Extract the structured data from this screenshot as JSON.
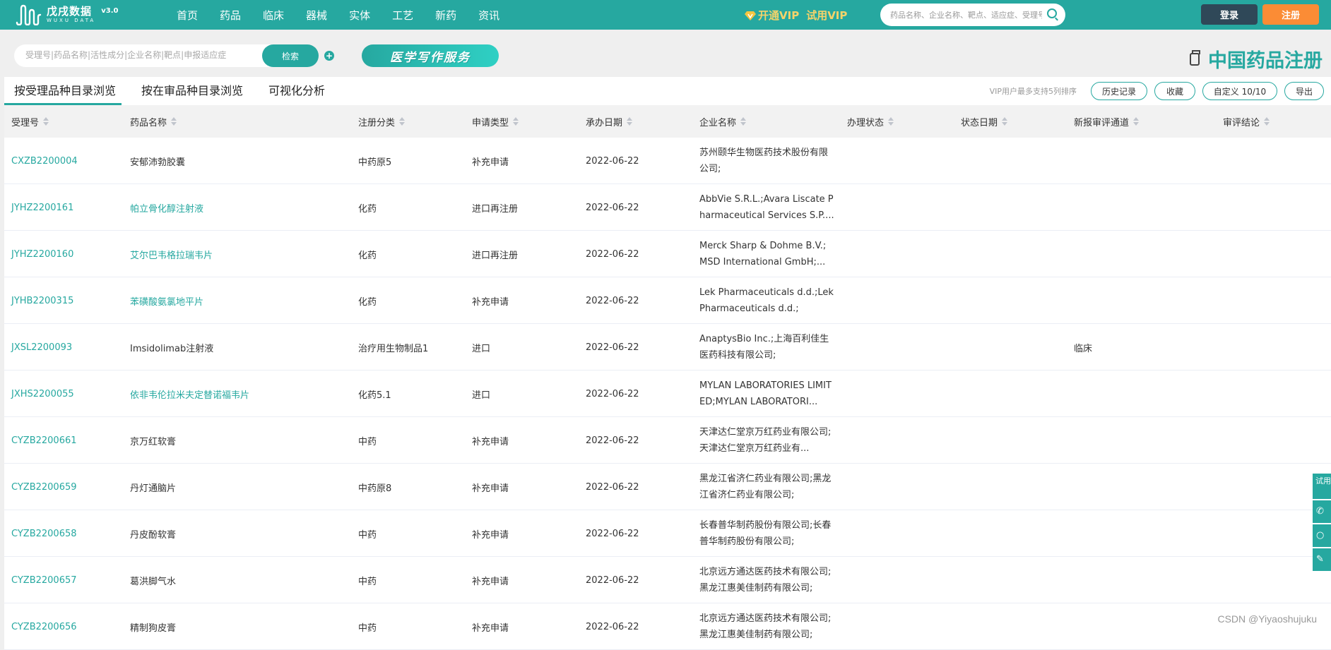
{
  "header": {
    "logo_cn": "戊戌数据",
    "logo_en": "WUXU DATA",
    "version": "v3.0",
    "nav": [
      "首页",
      "药品",
      "临床",
      "器械",
      "实体",
      "工艺",
      "新药",
      "资讯"
    ],
    "vip_open": "开通VIP",
    "vip_trial": "试用VIP",
    "search_placeholder": "药品名称、企业名称、靶点、适应症、受理号、批准文号、CTR号、NCT号",
    "login": "登录",
    "register": "注册",
    "brand_color": "#26a8a0",
    "login_color": "#2f4858",
    "register_color": "#fb8c35"
  },
  "subbar": {
    "search_placeholder": "受理号|药品名称|活性成分|企业名称|靶点|申报适应症",
    "search_button": "检索",
    "plus": "+",
    "banner": "医学写作服务",
    "page_title": "中国药品注册"
  },
  "tabs": [
    {
      "label": "按受理品种目录浏览",
      "active": true
    },
    {
      "label": "按在审品种目录浏览",
      "active": false
    },
    {
      "label": "可视化分析",
      "active": false
    }
  ],
  "tools": {
    "hint": "VIP用户最多支持5列排序",
    "history": "历史记录",
    "favorite": "收藏",
    "customize": "自定义 10/10",
    "export": "导出"
  },
  "table": {
    "columns": [
      "受理号",
      "药品名称",
      "注册分类",
      "申请类型",
      "承办日期",
      "企业名称",
      "办理状态",
      "状态日期",
      "新报审评通道",
      "审评结论"
    ],
    "rows": [
      {
        "id": "CXZB2200004",
        "name": "安郁沛勃胶囊",
        "name_link": false,
        "category": "中药原5",
        "type": "补充申请",
        "date": "2022-06-22",
        "company": "苏州颐华生物医药技术股份有限公司;",
        "status": "",
        "status_date": "",
        "channel": "",
        "conclusion": ""
      },
      {
        "id": "JYHZ2200161",
        "name": "帕立骨化醇注射液",
        "name_link": true,
        "category": "化药",
        "type": "进口再注册",
        "date": "2022-06-22",
        "company": "AbbVie S.R.L.;Avara Liscate Pharmaceutical Services S.P....",
        "status": "",
        "status_date": "",
        "channel": "",
        "conclusion": ""
      },
      {
        "id": "JYHZ2200160",
        "name": "艾尔巴韦格拉瑞韦片",
        "name_link": true,
        "category": "化药",
        "type": "进口再注册",
        "date": "2022-06-22",
        "company": "Merck Sharp & Dohme B.V.; MSD International GmbH;...",
        "status": "",
        "status_date": "",
        "channel": "",
        "conclusion": ""
      },
      {
        "id": "JYHB2200315",
        "name": "苯磺酸氨氯地平片",
        "name_link": true,
        "category": "化药",
        "type": "补充申请",
        "date": "2022-06-22",
        "company": "Lek Pharmaceuticals d.d.;Lek Pharmaceuticals d.d.;",
        "status": "",
        "status_date": "",
        "channel": "",
        "conclusion": ""
      },
      {
        "id": "JXSL2200093",
        "name": "Imsidolimab注射液",
        "name_link": false,
        "category": "治疗用生物制品1",
        "type": "进口",
        "date": "2022-06-22",
        "company": "AnaptysBio Inc.;上海百利佳生医药科技有限公司;",
        "status": "",
        "status_date": "",
        "channel": "临床",
        "conclusion": ""
      },
      {
        "id": "JXHS2200055",
        "name": "依非韦伦拉米夫定替诺福韦片",
        "name_link": true,
        "category": "化药5.1",
        "type": "进口",
        "date": "2022-06-22",
        "company": "MYLAN LABORATORIES LIMITED;MYLAN LABORATORI...",
        "status": "",
        "status_date": "",
        "channel": "",
        "conclusion": ""
      },
      {
        "id": "CYZB2200661",
        "name": "京万红软膏",
        "name_link": false,
        "category": "中药",
        "type": "补充申请",
        "date": "2022-06-22",
        "company": "天津达仁堂京万红药业有限公司;天津达仁堂京万红药业有...",
        "status": "",
        "status_date": "",
        "channel": "",
        "conclusion": ""
      },
      {
        "id": "CYZB2200659",
        "name": "丹灯通脑片",
        "name_link": false,
        "category": "中药原8",
        "type": "补充申请",
        "date": "2022-06-22",
        "company": "黑龙江省济仁药业有限公司;黑龙江省济仁药业有限公司;",
        "status": "",
        "status_date": "",
        "channel": "",
        "conclusion": ""
      },
      {
        "id": "CYZB2200658",
        "name": "丹皮酚软膏",
        "name_link": false,
        "category": "中药",
        "type": "补充申请",
        "date": "2022-06-22",
        "company": "长春普华制药股份有限公司;长春普华制药股份有限公司;",
        "status": "",
        "status_date": "",
        "channel": "",
        "conclusion": ""
      },
      {
        "id": "CYZB2200657",
        "name": "葛洪脚气水",
        "name_link": false,
        "category": "中药",
        "type": "补充申请",
        "date": "2022-06-22",
        "company": "北京远方通达医药技术有限公司;黑龙江惠美佳制药有限公司;",
        "status": "",
        "status_date": "",
        "channel": "",
        "conclusion": ""
      },
      {
        "id": "CYZB2200656",
        "name": "精制狗皮膏",
        "name_link": false,
        "category": "中药",
        "type": "补充申请",
        "date": "2022-06-22",
        "company": "北京远方通达医药技术有限公司;黑龙江惠美佳制药有限公司;",
        "status": "",
        "status_date": "",
        "channel": "",
        "conclusion": ""
      }
    ]
  },
  "float": {
    "trial": "试用申请",
    "icons": [
      "phone-icon",
      "wechat-icon",
      "feedback-icon"
    ]
  },
  "watermark": "CSDN @Yiyaoshujuku"
}
